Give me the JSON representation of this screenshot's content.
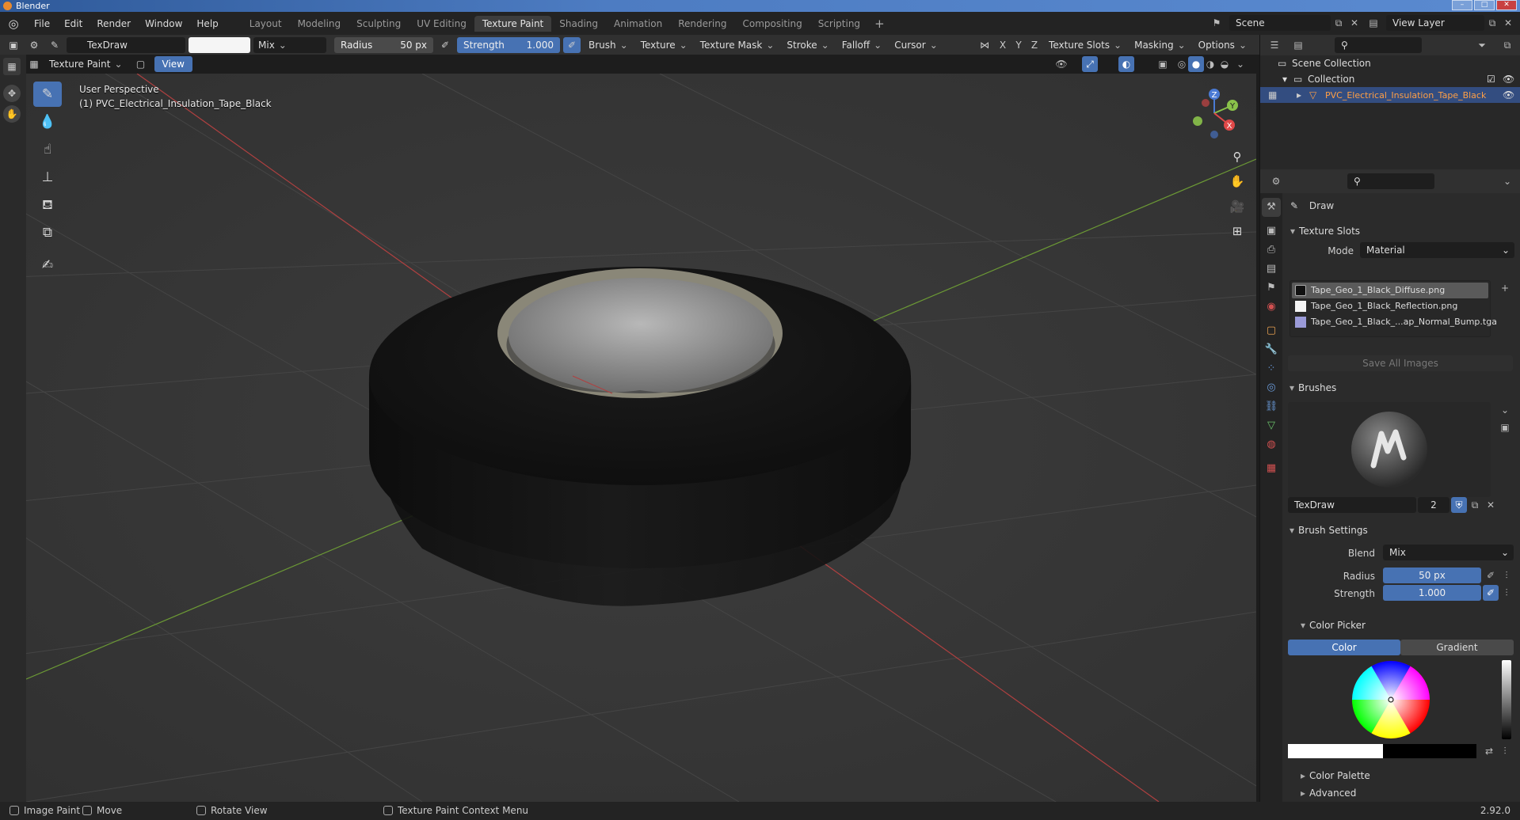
{
  "window": {
    "title": "Blender"
  },
  "menu": [
    "File",
    "Edit",
    "Render",
    "Window",
    "Help"
  ],
  "workspaces": [
    "Layout",
    "Modeling",
    "Sculpting",
    "UV Editing",
    "Texture Paint",
    "Shading",
    "Animation",
    "Rendering",
    "Compositing",
    "Scripting"
  ],
  "active_workspace": "Texture Paint",
  "scene": "Scene",
  "view_layer": "View Layer",
  "toolhdr": {
    "brush_name": "TexDraw",
    "blend": "Mix",
    "radius_label": "Radius",
    "radius_value": "50 px",
    "strength_label": "Strength",
    "strength_value": "1.000",
    "menus": [
      "Brush",
      "Texture",
      "Texture Mask",
      "Stroke",
      "Falloff",
      "Cursor"
    ],
    "axes": [
      "X",
      "Y",
      "Z"
    ],
    "right_menus": [
      "Texture Slots",
      "Masking",
      "Options"
    ]
  },
  "mode": {
    "label": "Texture Paint",
    "view": "View"
  },
  "viewport": {
    "perspective": "User Perspective",
    "object": "(1) PVC_Electrical_Insulation_Tape_Black"
  },
  "gizmo": {
    "z": "Z",
    "y": "Y",
    "x": "X"
  },
  "outliner": {
    "scene_collection": "Scene Collection",
    "collection": "Collection",
    "object": "PVC_Electrical_Insulation_Tape_Black"
  },
  "props": {
    "tool": "Draw",
    "texture_slots": {
      "title": "Texture Slots",
      "mode_label": "Mode",
      "mode_value": "Material",
      "slots": [
        "Tape_Geo_1_Black_Diffuse.png",
        "Tape_Geo_1_Black_Reflection.png",
        "Tape_Geo_1_Black_...ap_Normal_Bump.tga"
      ],
      "save_all": "Save All Images"
    },
    "brushes": {
      "title": "Brushes",
      "name": "TexDraw",
      "users": "2"
    },
    "brush_settings": {
      "title": "Brush Settings",
      "blend_label": "Blend",
      "blend_value": "Mix",
      "radius_label": "Radius",
      "radius_value": "50 px",
      "strength_label": "Strength",
      "strength_value": "1.000"
    },
    "color_picker": {
      "title": "Color Picker",
      "tab_color": "Color",
      "tab_gradient": "Gradient"
    },
    "color_palette": "Color Palette",
    "advanced": "Advanced"
  },
  "status": {
    "left": "Image Paint",
    "move": "Move",
    "rotate": "Rotate View",
    "context": "Texture Paint Context Menu",
    "version": "2.92.0"
  },
  "colors": {
    "accent": "#4772b3",
    "selection": "#334d80",
    "grid_x": "#b04040",
    "grid_y": "#6c9a35"
  }
}
